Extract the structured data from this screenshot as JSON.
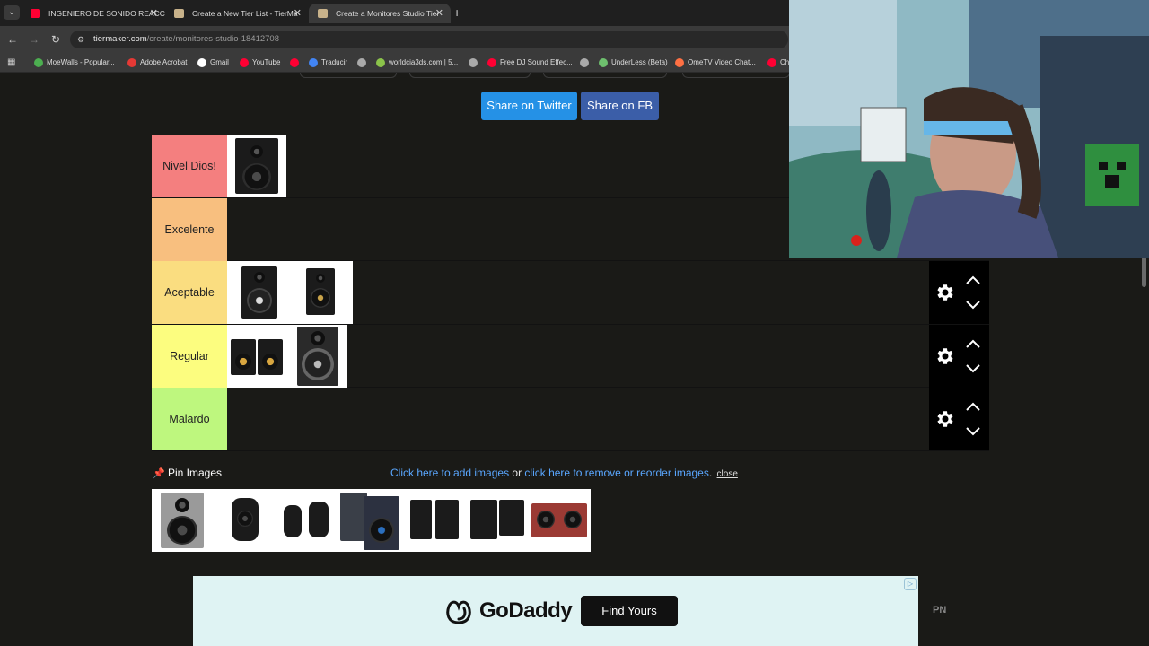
{
  "browser": {
    "tabs": [
      {
        "title": "INGENIERO DE SONIDO REACC",
        "favicon_color": "#ff0033",
        "active": false
      },
      {
        "title": "Create a New Tier List - TierMa",
        "favicon_color": "#c8b28a",
        "active": false
      },
      {
        "title": "Create a Monitores Studio Tier",
        "favicon_color": "#c8b28a",
        "active": true
      }
    ],
    "new_tab": "+",
    "url_host": "tiermaker.com",
    "url_path": "/create/monitores-studio-18412708",
    "bookmarks": [
      {
        "label": "MoeWalls - Popular...",
        "color": "#4caf50"
      },
      {
        "label": "Adobe Acrobat",
        "color": "#e53935"
      },
      {
        "label": "Gmail",
        "color": "#ffffff"
      },
      {
        "label": "YouTube",
        "color": "#ff0033"
      },
      {
        "label": "",
        "color": "#ff0033"
      },
      {
        "label": "Traducir",
        "color": "#4285f4"
      },
      {
        "label": "",
        "color": "#aaaaaa"
      },
      {
        "label": "worldcia3ds.com | 5...",
        "color": "#8bc34a"
      },
      {
        "label": "",
        "color": "#aaaaaa"
      },
      {
        "label": "Free DJ Sound Effec...",
        "color": "#ff0033"
      },
      {
        "label": "",
        "color": "#aaaaaa"
      },
      {
        "label": "UnderLess (Beta)",
        "color": "#6ec06e"
      },
      {
        "label": "OmeTV Video Chat...",
        "color": "#ff7043"
      },
      {
        "label": "Ch",
        "color": "#ff0033"
      }
    ]
  },
  "share": {
    "twitter": "Share on Twitter",
    "fb": "Share on FB"
  },
  "tiers": [
    {
      "label": "Nivel Dios!",
      "color": "#f47f7f",
      "items": 1,
      "controls": false
    },
    {
      "label": "Excelente",
      "color": "#f8bf7f",
      "items": 0,
      "controls": false
    },
    {
      "label": "Aceptable",
      "color": "#fadd80",
      "items": 2,
      "controls": true
    },
    {
      "label": "Regular",
      "color": "#fcfd7f",
      "items": 2,
      "controls": true
    },
    {
      "label": "Malardo",
      "color": "#bef77e",
      "items": 0,
      "controls": true
    }
  ],
  "pin": {
    "title": "Pin Images",
    "add_link": "Click here to add images",
    "or": " or ",
    "remove_link": "click here to remove or reorder images",
    "period": ".",
    "close": "close",
    "pool_count": 7
  },
  "ad": {
    "brand": "GoDaddy",
    "cta": "Find Yours",
    "choices": "▷",
    "side_text": "PN"
  }
}
